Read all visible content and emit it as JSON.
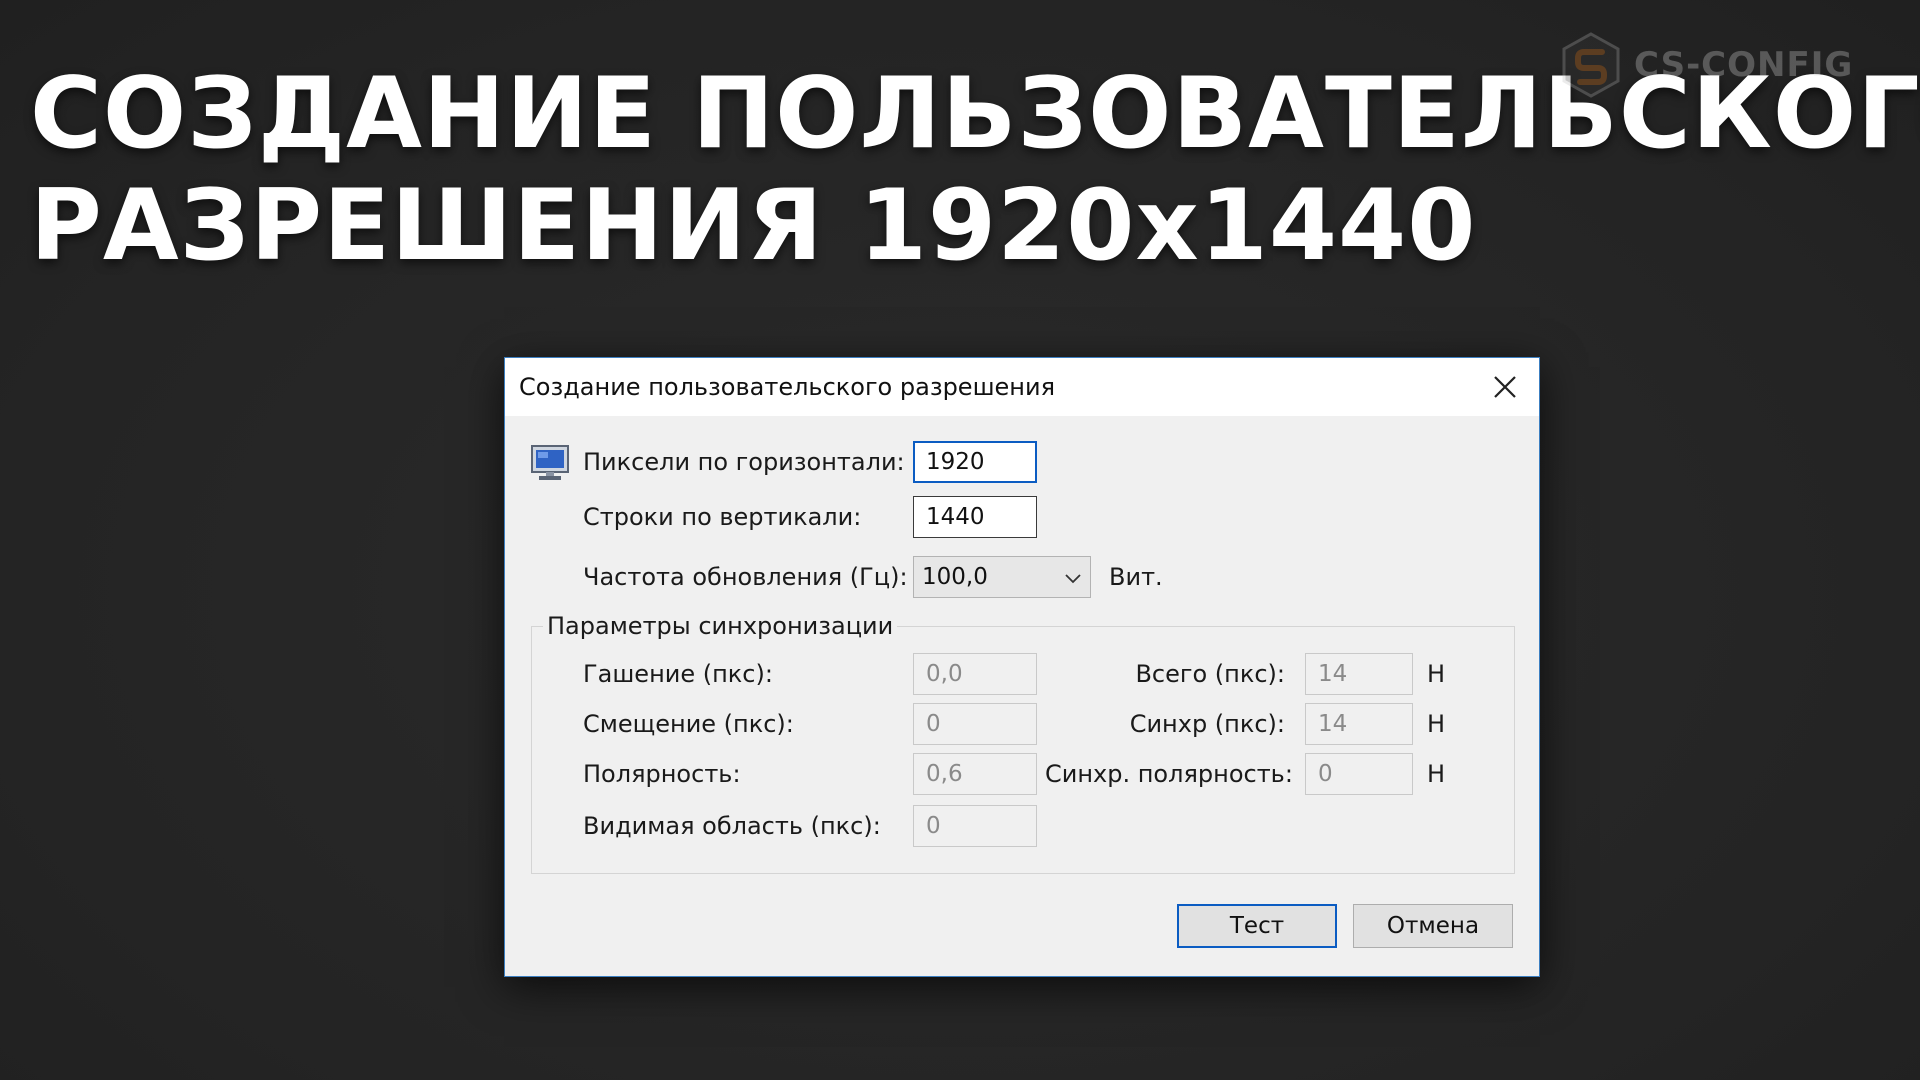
{
  "headline": {
    "line1": "СОЗДАНИЕ ПОЛЬЗОВАТЕЛЬСКОГО",
    "line2": "РАЗРЕШЕНИЯ 1920x1440"
  },
  "brand": {
    "name": "CS-CONFIG",
    "icon": "cs-config-logo",
    "accent": "#f0821e"
  },
  "dialog": {
    "title": "Создание пользовательского разрешения",
    "close_icon": "close-icon",
    "horizontal_label": "Пиксели по горизонтали:",
    "horizontal_value": "1920",
    "vertical_label": "Строки по вертикали:",
    "vertical_value": "1440",
    "refresh_label": "Частота обновления (Гц):",
    "refresh_value": "100,0",
    "refresh_suffix": "Вит.",
    "sync": {
      "legend": "Параметры синхронизации",
      "left_rows": [
        {
          "label": "Гашение (пкс):",
          "value": "0,0"
        },
        {
          "label": "Смещение (пкс):",
          "value": "0"
        },
        {
          "label": "Полярность:",
          "value": "0,6"
        },
        {
          "label": "Видимая область (пкс):",
          "value": "0"
        }
      ],
      "right_rows": [
        {
          "label": "Всего (пкс):",
          "value": "14",
          "unit": "Н"
        },
        {
          "label": "Синхр (пкс):",
          "value": "14",
          "unit": "Н"
        },
        {
          "label": "Синхр. полярность:",
          "value": "0",
          "unit": "Н"
        }
      ]
    },
    "test_button": "Тест",
    "cancel_button": "Отмена",
    "focus_color": "#0b5cc2"
  }
}
